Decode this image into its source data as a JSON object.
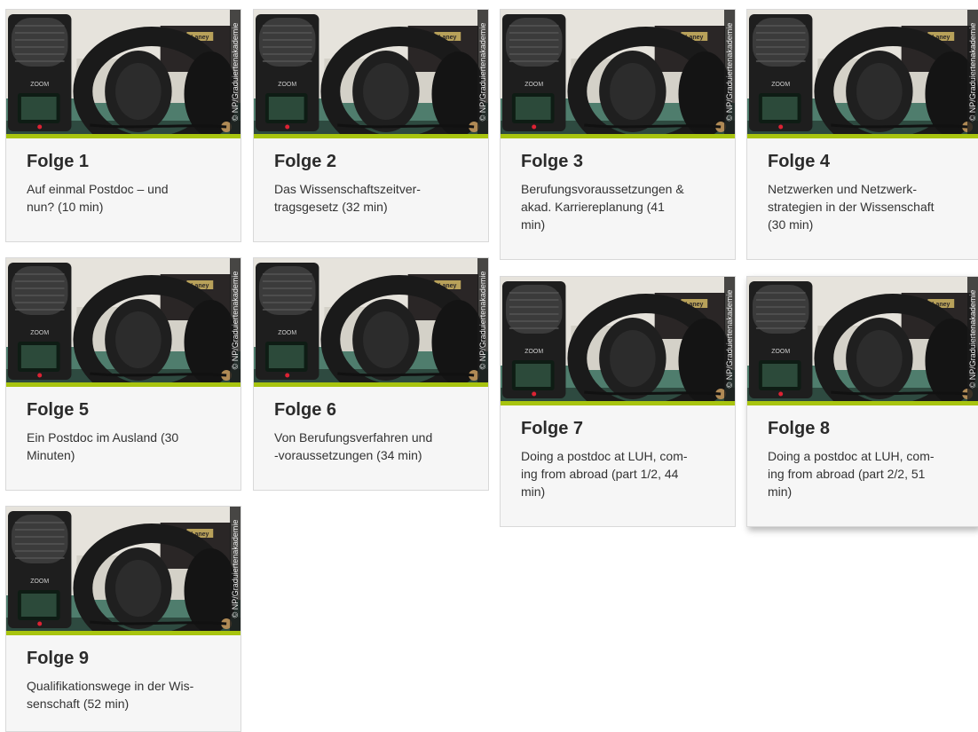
{
  "image": {
    "credit": "© NP/Graduiertenakademie",
    "brand": "ZOOM",
    "amp_brand": "Laney"
  },
  "colors": {
    "accent_green": "#a8c40f",
    "card_background": "#f6f6f6",
    "card_border": "#d9d9d9",
    "title_text": "#2b2b2b"
  },
  "episodes": [
    {
      "title": "Folge 1",
      "description": "Auf einmal Postdoc – und\nnun? (10 min)"
    },
    {
      "title": "Folge 2",
      "description": "Das Wissenschaftszeitver-\ntragsgesetz (32 min)"
    },
    {
      "title": "Folge 3",
      "description": "Berufungsvoraussetzungen &\nakad. Karriereplanung (41\nmin)"
    },
    {
      "title": "Folge 4",
      "description": "Netzwerken und Netzwerk-\nstrategien in der Wissenschaft\n(30 min)"
    },
    {
      "title": "Folge 5",
      "description": "Ein Postdoc im Ausland (30\nMinuten)"
    },
    {
      "title": "Folge 6",
      "description": "Von Berufungsverfahren und\n-voraussetzungen (34 min)"
    },
    {
      "title": "Folge 7",
      "description": "Doing a postdoc at LUH, com-\ning from abroad (part 1/2, 44\nmin)"
    },
    {
      "title": "Folge 8",
      "description": "Doing a postdoc at LUH, com-\ning from abroad (part 2/2, 51\nmin)"
    },
    {
      "title": "Folge 9",
      "description": "Qualifikationswege in der Wis-\nsenschaft (52 min)"
    }
  ]
}
